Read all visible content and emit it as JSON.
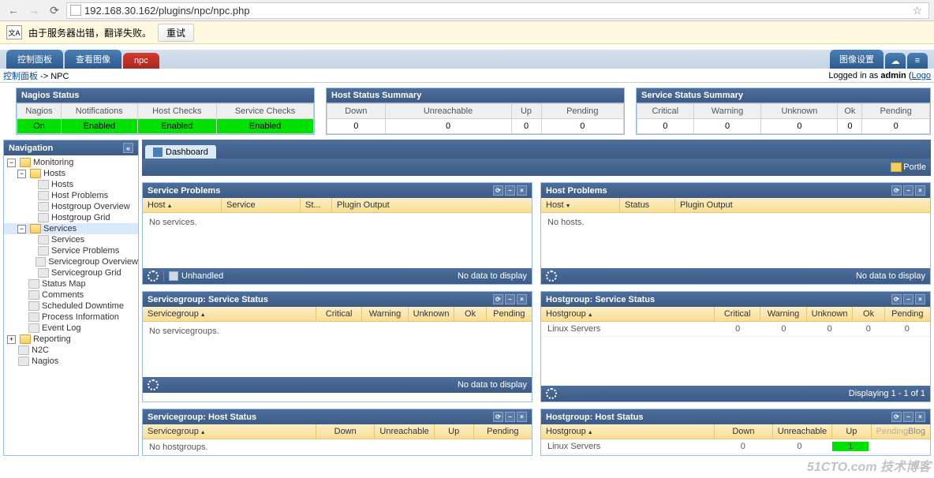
{
  "browser": {
    "url": "192.168.30.162/plugins/npc/npc.php"
  },
  "translate": {
    "message": "由于服务器出错，翻译失败。",
    "retry": "重试",
    "icon_label": "文A"
  },
  "tabs": {
    "control_panel": "控制面板",
    "view_image": "查看图像",
    "npc": "npc",
    "image_settings": "图像设置"
  },
  "breadcrumb": {
    "control_panel": "控制面板",
    "sep": " -> ",
    "current": "NPC",
    "login_prefix": "Logged in as ",
    "login_user": "admin",
    "logout": "Logo"
  },
  "nagios_status": {
    "title": "Nagios Status",
    "cols": [
      "Nagios",
      "Notifications",
      "Host Checks",
      "Service Checks"
    ],
    "vals": [
      "On",
      "Enabled",
      "Enabled",
      "Enabled"
    ]
  },
  "host_summary": {
    "title": "Host Status Summary",
    "cols": [
      "Down",
      "Unreachable",
      "Up",
      "Pending"
    ],
    "vals": [
      "0",
      "0",
      "0",
      "0"
    ]
  },
  "service_summary": {
    "title": "Service Status Summary",
    "cols": [
      "Critical",
      "Warning",
      "Unknown",
      "Ok",
      "Pending"
    ],
    "vals": [
      "0",
      "0",
      "0",
      "0",
      "0"
    ]
  },
  "nav": {
    "title": "Navigation",
    "tree": {
      "monitoring": "Monitoring",
      "hosts": "Hosts",
      "hosts_children": [
        "Hosts",
        "Host Problems",
        "Hostgroup Overview",
        "Hostgroup Grid"
      ],
      "services": "Services",
      "services_children": [
        "Services",
        "Service Problems",
        "Servicegroup Overview",
        "Servicegroup Grid"
      ],
      "others": [
        "Status Map",
        "Comments",
        "Scheduled Downtime",
        "Process Information",
        "Event Log"
      ],
      "reporting": "Reporting",
      "n2c": "N2C",
      "nagios": "Nagios"
    }
  },
  "dashboard_tab": "Dashboard",
  "portlet_btn": "Portle",
  "portlets": {
    "service_problems": {
      "title": "Service Problems",
      "cols": [
        "Host",
        "Service",
        "St...",
        "Plugin Output"
      ],
      "empty": "No services.",
      "unhandled": "Unhandled",
      "footer_right": "No data to display"
    },
    "host_problems": {
      "title": "Host Problems",
      "cols": [
        "Host",
        "Status",
        "Plugin Output"
      ],
      "empty": "No hosts.",
      "footer_right": "No data to display"
    },
    "sg_service": {
      "title": "Servicegroup: Service Status",
      "cols": [
        "Servicegroup",
        "Critical",
        "Warning",
        "Unknown",
        "Ok",
        "Pending"
      ],
      "empty": "No servicegroups.",
      "footer_right": "No data to display"
    },
    "hg_service": {
      "title": "Hostgroup: Service Status",
      "cols": [
        "Hostgroup",
        "Critical",
        "Warning",
        "Unknown",
        "Ok",
        "Pending"
      ],
      "row_name": "Linux Servers",
      "row_vals": [
        "0",
        "0",
        "0",
        "0",
        "0"
      ],
      "footer_right": "Displaying 1 - 1 of 1"
    },
    "sg_host": {
      "title": "Servicegroup: Host Status",
      "cols": [
        "Servicegroup",
        "Down",
        "Unreachable",
        "Up",
        "Pending"
      ],
      "empty": "No hostgroups."
    },
    "hg_host": {
      "title": "Hostgroup: Host Status",
      "cols": [
        "Hostgroup",
        "Down",
        "Unreachable",
        "Up",
        "Pending"
      ],
      "row_name": "Linux Servers",
      "row_vals": [
        "0",
        "0",
        "1",
        ""
      ],
      "suffix": "Blog"
    }
  },
  "watermark": "51CTO.com 技术博客"
}
